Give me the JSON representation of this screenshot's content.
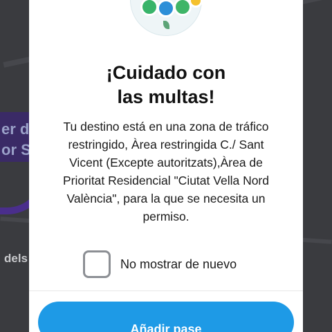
{
  "map": {
    "pill_text": "er de\nor Sc",
    "street_text": "dels"
  },
  "dialog": {
    "title_line1": "¡Cuidado con",
    "title_line2": "las multas!",
    "message": "Tu destino está en una zona de tráfico restringido, Àrea restringida C./ Sant Vicent (Excepte autoritzats),Àrea de Prioritat Residencial \"Ciutat Vella Nord València\", para la que se necesita un permiso.",
    "checkbox_label": "No mostrar de nuevo",
    "checkbox_checked": false,
    "primary_button": "Añadir pase"
  },
  "colors": {
    "accent": "#1e9ae6",
    "map_background": "#3a3b3f",
    "route": "#4a2e8c"
  }
}
